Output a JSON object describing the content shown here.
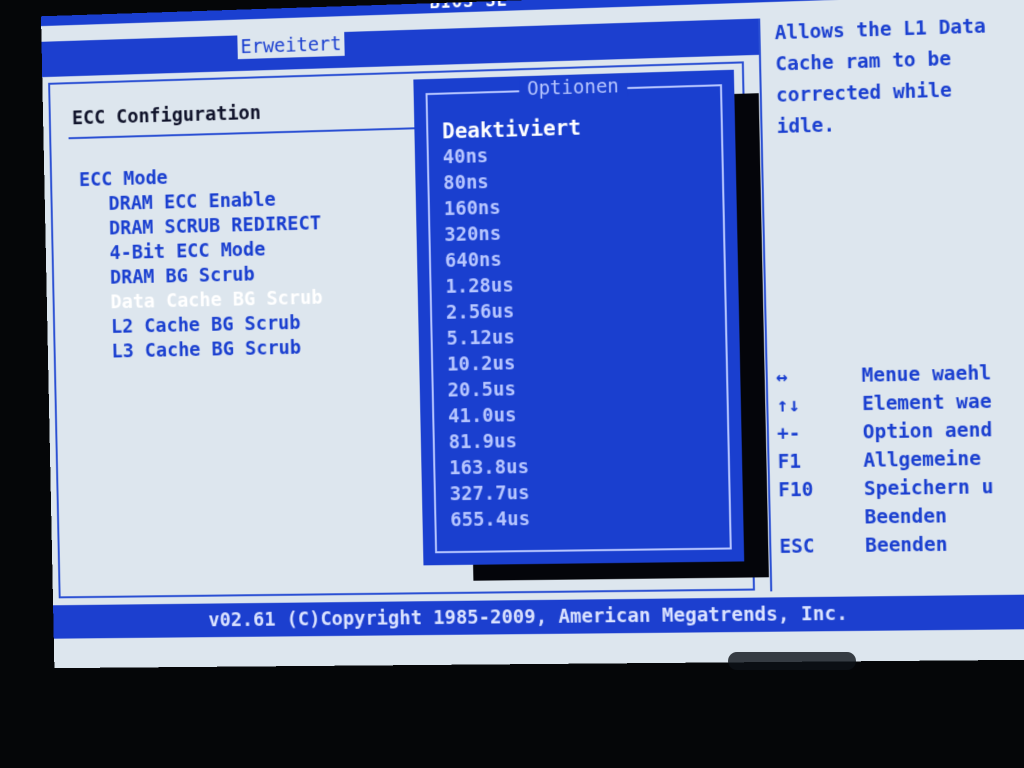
{
  "header": {
    "bios_title": "BIOS SE",
    "active_tab": "Erweitert"
  },
  "main": {
    "section_title": "ECC Configuration",
    "items": [
      {
        "label": "ECC Mode"
      },
      {
        "label": "DRAM ECC Enable"
      },
      {
        "label": "DRAM SCRUB REDIRECT"
      },
      {
        "label": "4-Bit ECC Mode"
      },
      {
        "label": "DRAM BG Scrub"
      },
      {
        "label": "Data Cache BG Scrub"
      },
      {
        "label": "L2 Cache BG Scrub"
      },
      {
        "label": "L3 Cache BG Scrub"
      }
    ]
  },
  "dropdown": {
    "title": "Optionen",
    "options": [
      "Deaktiviert",
      "40ns",
      "80ns",
      "160ns",
      "320ns",
      "640ns",
      "1.28us",
      "2.56us",
      "5.12us",
      "10.2us",
      "20.5us",
      "41.0us",
      "81.9us",
      "163.8us",
      "327.7us",
      "655.4us"
    ]
  },
  "help": {
    "text": "Allows the L1 Data Cache ram to be corrected while idle.",
    "keys": [
      {
        "key": "↔",
        "desc": "Menue waehl"
      },
      {
        "key": "↑↓",
        "desc": "Element wae"
      },
      {
        "key": "+-",
        "desc": "Option aend"
      },
      {
        "key": "F1",
        "desc": "Allgemeine"
      },
      {
        "key": "F10",
        "desc": "Speichern u"
      },
      {
        "key": "",
        "desc": "Beenden"
      },
      {
        "key": "ESC",
        "desc": "Beenden"
      }
    ]
  },
  "footer": {
    "status": "v02.61 (C)Copyright 1985-2009, American Megatrends, Inc."
  },
  "colors": {
    "bios_blue": "#1a3fd0",
    "panel_bg": "#dde6ee",
    "selected_text": "#ffffff"
  }
}
